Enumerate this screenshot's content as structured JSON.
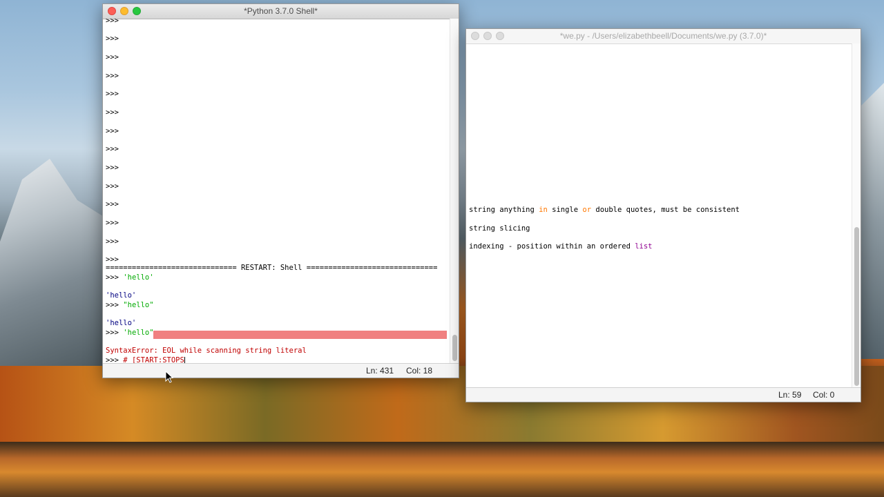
{
  "shell_window": {
    "title": "*Python 3.7.0 Shell*",
    "prompts": [
      ">>>",
      ">>>",
      ">>>",
      ">>>",
      ">>>",
      ">>>",
      ">>>",
      ">>>",
      ">>>",
      ">>>",
      ">>>",
      ">>>",
      ">>>",
      ">>>"
    ],
    "restart_line": "============================== RESTART: Shell ==============================",
    "history": {
      "prompt": ">>>",
      "input1": "'hello'",
      "output1": "'hello'",
      "input2": "\"hello\"",
      "output2": "'hello'",
      "input3": "'hello\"",
      "error": "SyntaxError: EOL while scanning string literal",
      "current_input": "# [START:STOPS"
    },
    "status": {
      "line": "Ln: 431",
      "col": "Col: 18"
    }
  },
  "editor_window": {
    "title": "*we.py - /Users/elizabethbeell/Documents/we.py (3.7.0)*",
    "lines": {
      "l1_a": "string anything ",
      "l1_kw1": "in",
      "l1_b": " single ",
      "l1_kw2": "or",
      "l1_c": " double quotes, must be consistent",
      "l2": "string slicing",
      "l3_a": "indexing - position within an ordered ",
      "l3_builtin": "list"
    },
    "status": {
      "line": "Ln: 59",
      "col": "Col: 0"
    }
  },
  "colors": {
    "string": "#00aa00",
    "output": "#000080",
    "error": "#c00000",
    "keyword": "#ff7700",
    "builtin": "#900090",
    "error_highlight": "#f08080"
  }
}
